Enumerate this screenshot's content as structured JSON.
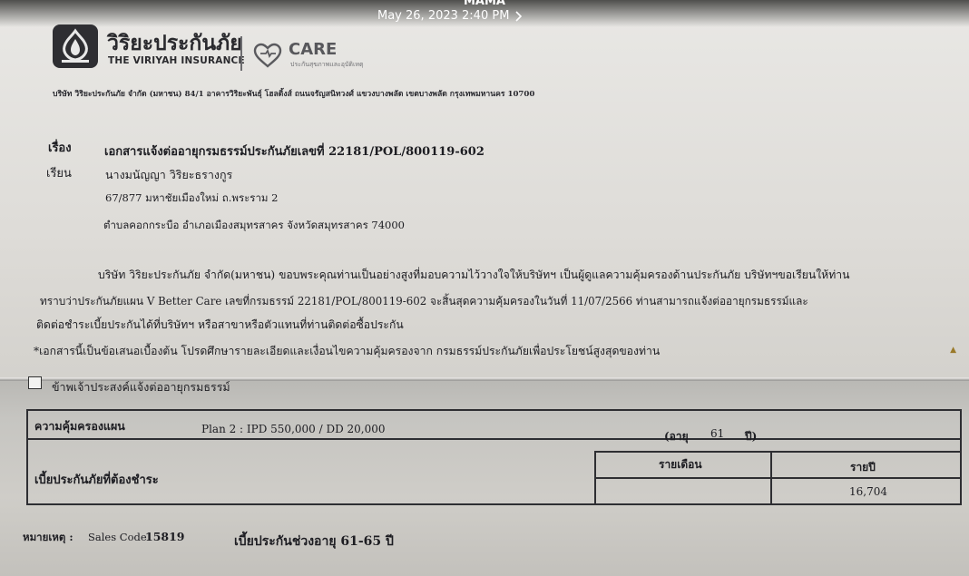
{
  "screen": {
    "title": "MAMA",
    "date": "May 26, 2023 2:40 PM"
  },
  "letter": {
    "logo_th": "วิริยะประกันภัย",
    "logo_en": "THE VIRIYAH INSURANCE",
    "care_brand": "CARE",
    "care_sub": "ประกันสุขภาพและอุบัติเหตุ",
    "address": "บริษัท วิริยะประกันภัย จำกัด (มหาชน) 84/1 อาคารวิริยะพันธุ์ โฮลดิ้งส์ ถนนจรัญสนิทวงศ์ แขวงบางพลัด เขตบางพลัด กรุงเทพมหานคร 10700",
    "subject_label": "เรื่อง",
    "subject": "เอกสารแจ้งต่ออายุกรมธรรม์ประกันภัยเลขที่ 22181/POL/800119-602",
    "to_label": "เรียน",
    "recipient_name": "นางมนัญญา วิริยะธรางกูร",
    "recipient_addr1": "67/877 มหาชัยเมืองใหม่ ถ.พระราม 2",
    "recipient_addr2": "ตำบลคอกกระบือ อำเภอเมืองสมุทรสาคร จังหวัดสมุทรสาคร 74000",
    "para1": "บริษัท วิริยะประกันภัย จำกัด(มหาชน) ขอบพระคุณท่านเป็นอย่างสูงที่มอบความไว้วางใจให้บริษัทฯ เป็นผู้ดูแลความคุ้มครองด้านประกันภัย บริษัทฯขอเรียนให้ท่าน",
    "para2": "ทราบว่าประกันภัยแผน  V Better Care  เลขที่กรมธรรม์  22181/POL/800119-602  จะสิ้นสุดความคุ้มครองในวันที่   11/07/2566  ท่านสามารถแจ้งต่ออายุกรมธรรม์และ",
    "para3": "ติดต่อชำระเบี้ยประกันได้ที่บริษัทฯ หรือสาขาหรือตัวแทนที่ท่านติดต่อซื้อประกัน",
    "note": "*เอกสารนี้เป็นข้อเสนอเบื้องต้น โปรดศึกษารายละเอียดและเงื่อนไขความคุ้มครองจาก กรมธรรม์ประกันภัยเพื่อประโยชน์สูงสุดของท่าน",
    "checkbox_label": "ข้าพเจ้าประสงค์แจ้งต่ออายุกรมธรรม์"
  },
  "table": {
    "plan_label": "ความคุ้มครองแผน",
    "plan_value": "Plan 2 : IPD 550,000 / DD 20,000",
    "age_label": "(อายุ",
    "age_value": "61",
    "age_unit": "ปี)",
    "premium_label": "เบี้ยประกันภัยที่ต้องชำระ",
    "col_monthly": "รายเดือน",
    "col_yearly": "รายปี",
    "monthly_value": "",
    "yearly_value": "16,704"
  },
  "footer": {
    "remark_label": "หมายเหตุ :",
    "sales_code_label": "Sales Code",
    "sales_code": "15819",
    "premium_range": "เบี้ยประกันช่วงอายุ 61-65 ปี"
  }
}
